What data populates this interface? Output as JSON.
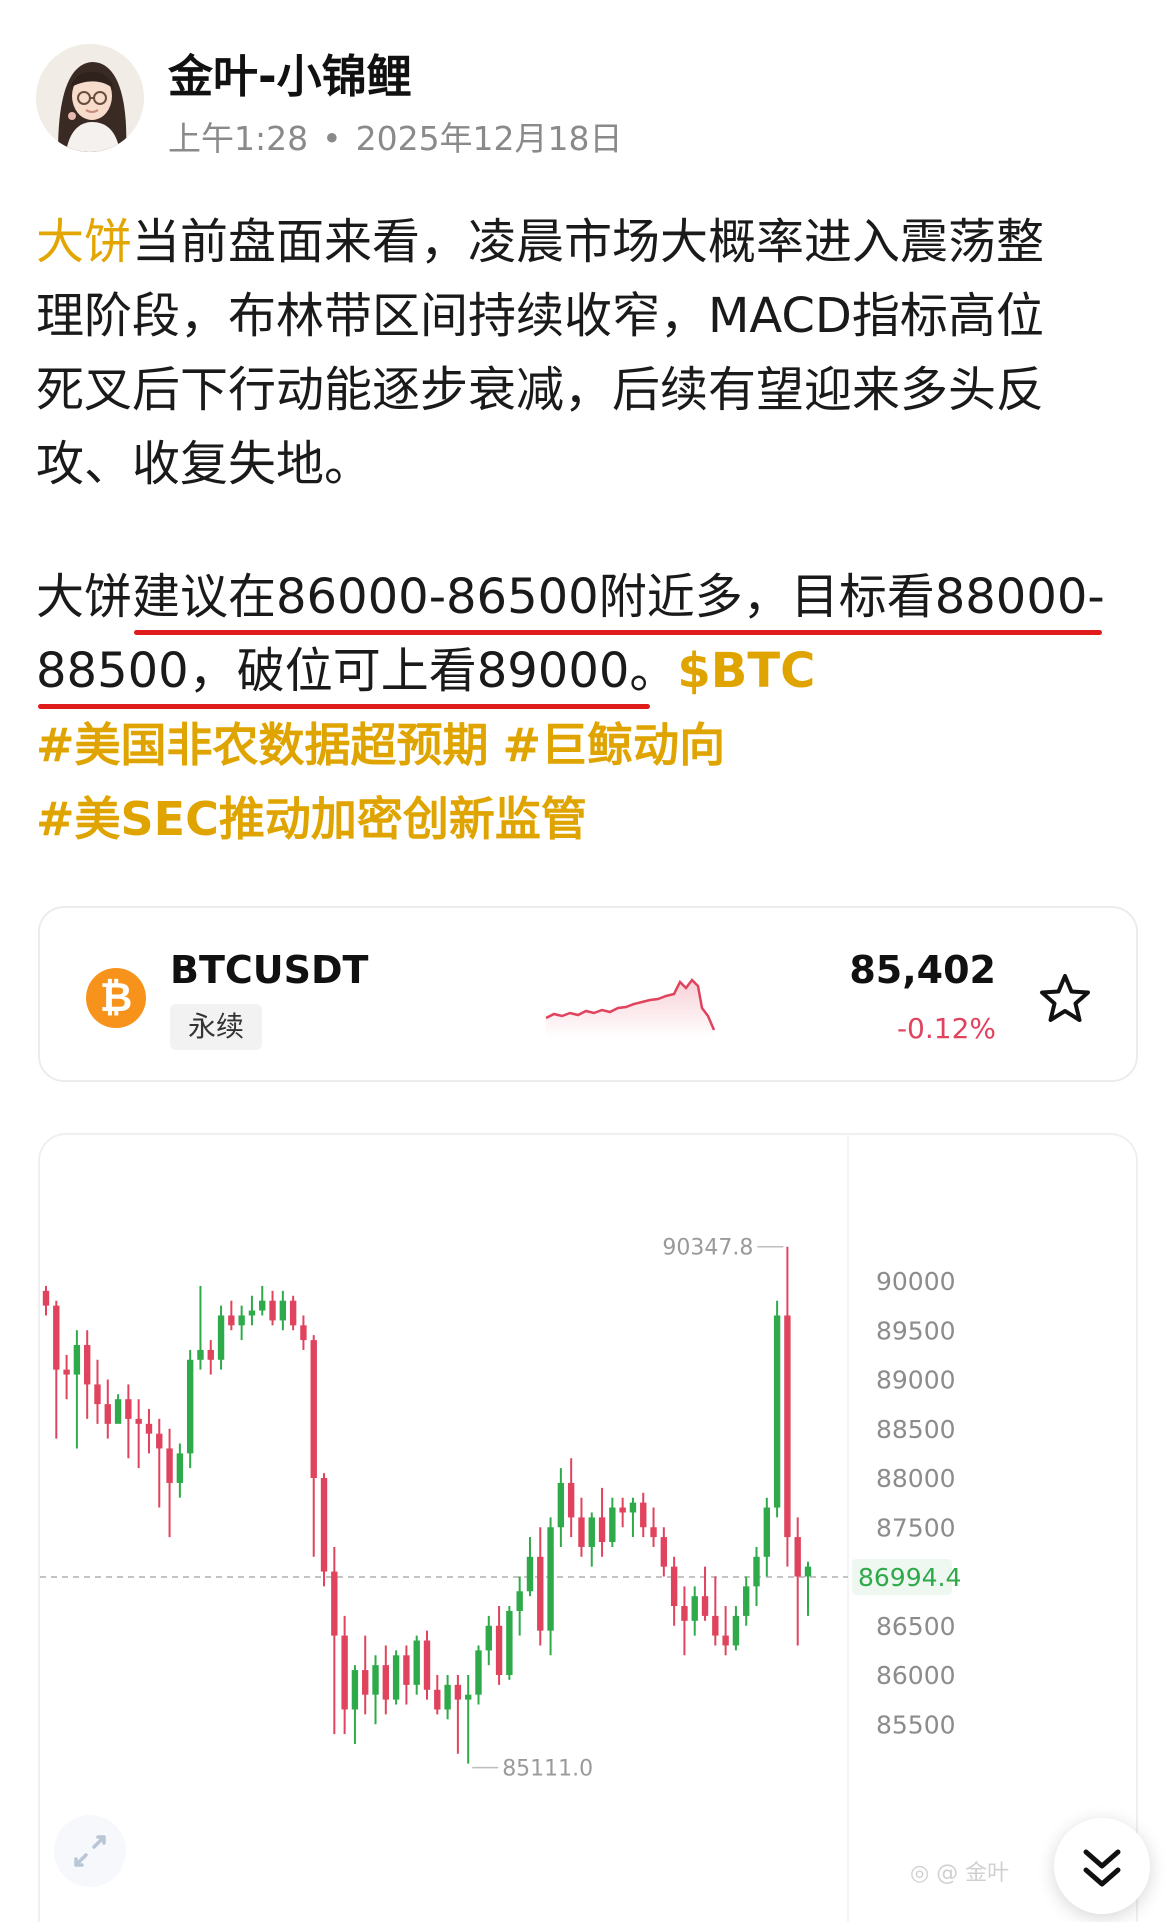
{
  "author": {
    "name": "金叶-小锦鲤",
    "time": "上午1:28",
    "date": "2025年12月18日"
  },
  "post": {
    "line1_highlight": "大饼",
    "line1_rest": "当前盘面来看，凌晨市场大概率进入震荡整",
    "line2": "理阶段，布林带区间持续收窄，MACD指标高位",
    "line3": "死叉后下行动能逐步衰减，后续有望迎来多头反",
    "line4": "攻、收复失地。",
    "line5": "大饼建议在86000-86500附近多，目标看88000-",
    "line6": "88500，破位可上看89000。",
    "cashtag": "$BTC",
    "hashtags": [
      "#美国非农数据超预期",
      "#巨鲸动向",
      "#美SEC推动加密创新监管"
    ]
  },
  "ticker": {
    "symbol": "BTCUSDT",
    "contract": "永续",
    "price": "85,402",
    "change": "-0.12%",
    "coin_icon": "bitcoin-icon",
    "favorite_icon": "star-icon",
    "change_color": "#e0435d"
  },
  "chart_data": {
    "type": "candlestick",
    "y_ticks": [
      "90000",
      "89500",
      "89000",
      "88500",
      "88000",
      "87500",
      "86994.4",
      "86500",
      "86000",
      "85500"
    ],
    "ylim": [
      85000,
      90650
    ],
    "current_price": 86994.4,
    "current_price_label": "86994.4",
    "high_label": "90347.8",
    "low_label": "85111.0",
    "up_color": "#2eaa4a",
    "down_color": "#e0435d",
    "candles": [
      [
        89900,
        89950,
        89650,
        89750
      ],
      [
        89750,
        89800,
        88400,
        89100
      ],
      [
        89100,
        89250,
        88800,
        89050
      ],
      [
        89050,
        89500,
        88300,
        89350
      ],
      [
        89350,
        89500,
        88600,
        88950
      ],
      [
        88950,
        89200,
        88550,
        88750
      ],
      [
        88750,
        89000,
        88400,
        88550
      ],
      [
        88550,
        88850,
        88600,
        88800
      ],
      [
        88800,
        88950,
        88200,
        88600
      ],
      [
        88600,
        88800,
        88100,
        88550
      ],
      [
        88550,
        88700,
        88250,
        88450
      ],
      [
        88450,
        88600,
        87700,
        88300
      ],
      [
        88300,
        88500,
        87400,
        87950
      ],
      [
        87950,
        88350,
        87800,
        88250
      ],
      [
        88250,
        89300,
        88100,
        89200
      ],
      [
        89200,
        89950,
        89100,
        89300
      ],
      [
        89300,
        89400,
        89050,
        89200
      ],
      [
        89200,
        89750,
        89100,
        89650
      ],
      [
        89650,
        89800,
        89500,
        89550
      ],
      [
        89550,
        89750,
        89400,
        89650
      ],
      [
        89650,
        89850,
        89550,
        89700
      ],
      [
        89700,
        89950,
        89650,
        89800
      ],
      [
        89800,
        89900,
        89550,
        89600
      ],
      [
        89600,
        89900,
        89500,
        89800
      ],
      [
        89800,
        89850,
        89500,
        89550
      ],
      [
        89550,
        89650,
        89300,
        89400
      ],
      [
        89400,
        89450,
        87200,
        88000
      ],
      [
        88000,
        88050,
        86900,
        87050
      ],
      [
        87050,
        87300,
        85400,
        86400
      ],
      [
        86400,
        86600,
        85400,
        85650
      ],
      [
        85650,
        86100,
        85300,
        86050
      ],
      [
        86050,
        86400,
        85600,
        85800
      ],
      [
        85800,
        86200,
        85500,
        86100
      ],
      [
        86100,
        86300,
        85600,
        85750
      ],
      [
        85750,
        86250,
        85700,
        86200
      ],
      [
        86200,
        86300,
        85700,
        85900
      ],
      [
        85900,
        86400,
        85800,
        86350
      ],
      [
        86350,
        86450,
        85750,
        85850
      ],
      [
        85850,
        86000,
        85600,
        85650
      ],
      [
        85650,
        86000,
        85550,
        85900
      ],
      [
        85900,
        86000,
        85200,
        85750
      ],
      [
        85750,
        86000,
        85100,
        85800
      ],
      [
        85800,
        86300,
        85700,
        86250
      ],
      [
        86250,
        86600,
        86100,
        86500
      ],
      [
        86500,
        86700,
        85900,
        86000
      ],
      [
        86000,
        86700,
        85950,
        86650
      ],
      [
        86650,
        87000,
        86400,
        86850
      ],
      [
        86850,
        87400,
        86800,
        87200
      ],
      [
        87200,
        87500,
        86300,
        86450
      ],
      [
        86450,
        87600,
        86200,
        87500
      ],
      [
        87500,
        88100,
        87300,
        87950
      ],
      [
        87950,
        88200,
        87400,
        87600
      ],
      [
        87600,
        87800,
        87200,
        87300
      ],
      [
        87300,
        87650,
        87100,
        87600
      ],
      [
        87600,
        87900,
        87200,
        87350
      ],
      [
        87350,
        87800,
        87300,
        87700
      ],
      [
        87700,
        87800,
        87500,
        87650
      ],
      [
        87650,
        87800,
        87400,
        87750
      ],
      [
        87750,
        87850,
        87400,
        87500
      ],
      [
        87500,
        87700,
        87300,
        87400
      ],
      [
        87400,
        87500,
        87000,
        87100
      ],
      [
        87100,
        87200,
        86500,
        86700
      ],
      [
        86700,
        86900,
        86200,
        86550
      ],
      [
        86550,
        86900,
        86400,
        86800
      ],
      [
        86800,
        87100,
        86550,
        86600
      ],
      [
        86600,
        87000,
        86300,
        86400
      ],
      [
        86400,
        86700,
        86200,
        86300
      ],
      [
        86300,
        86700,
        86250,
        86600
      ],
      [
        86600,
        87000,
        86500,
        86900
      ],
      [
        86900,
        87300,
        86700,
        87200
      ],
      [
        87200,
        87800,
        87000,
        87700
      ],
      [
        87700,
        89800,
        87600,
        89650
      ],
      [
        89650,
        90347.8,
        87100,
        87400
      ],
      [
        87400,
        87600,
        86300,
        87000
      ],
      [
        87000,
        87150,
        86600,
        87100
      ]
    ]
  }
}
